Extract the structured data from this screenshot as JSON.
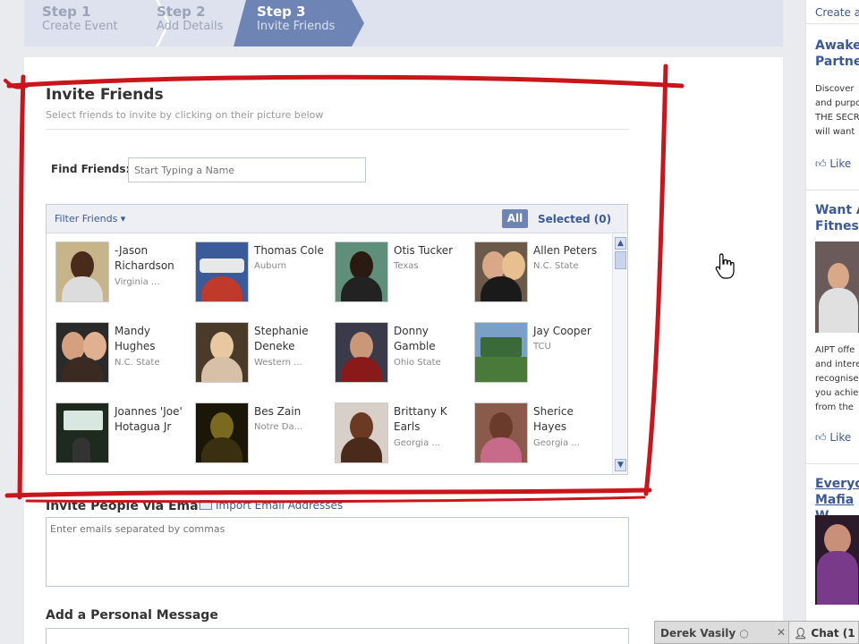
{
  "steps": [
    {
      "num": "Step 1",
      "label": "Create Event"
    },
    {
      "num": "Step 2",
      "label": "Add Details"
    },
    {
      "num": "Step 3",
      "label": "Invite Friends"
    }
  ],
  "invite": {
    "title": "Invite Friends",
    "subtitle": "Select friends to invite by clicking on their picture below",
    "find_label": "Find Friends:",
    "find_placeholder": "Start Typing a Name",
    "filter_label": "Filter Friends ▾",
    "all_label": "All",
    "selected_label": "Selected (0)"
  },
  "friends": [
    {
      "name": "-Jason Richardson",
      "network": "Virginia ..."
    },
    {
      "name": "Thomas Cole",
      "network": "Auburn"
    },
    {
      "name": "Otis Tucker",
      "network": "Texas"
    },
    {
      "name": "Allen Peters",
      "network": "N.C. State"
    },
    {
      "name": "Mandy Hughes",
      "network": "N.C. State"
    },
    {
      "name": "Stephanie Deneke",
      "network": "Western ..."
    },
    {
      "name": "Donny Gamble",
      "network": "Ohio State"
    },
    {
      "name": "Jay Cooper",
      "network": "TCU"
    },
    {
      "name": "Joannes 'Joe' Hotagua Jr",
      "network": ""
    },
    {
      "name": "Bes Zain",
      "network": "Notre Da..."
    },
    {
      "name": "Brittany K Earls",
      "network": "Georgia ..."
    },
    {
      "name": "Sherice Hayes",
      "network": "Georgia ..."
    }
  ],
  "email": {
    "title": "Invite People via Email",
    "import_label": "Import Email Addresses",
    "placeholder": "Enter emails separated by commas"
  },
  "message": {
    "title": "Add a Personal Message"
  },
  "sidebar": {
    "create_link": "Create an",
    "ads": [
      {
        "title": "Awaken Partner",
        "lines": [
          "Discover",
          "and purpo",
          "THE SECR",
          "will want"
        ],
        "like": "Like"
      },
      {
        "title": "Want A Fitness",
        "lines": [
          "AIPT offe",
          "and intere",
          "recognise",
          "you achie",
          "from the"
        ],
        "like": "Like"
      },
      {
        "title": "Everyon Mafia W",
        "lines": [],
        "like": ""
      }
    ]
  },
  "chat": {
    "tab_user": "Derek Vasily",
    "status_icon": "○",
    "close": "✕",
    "chat_label": "Chat (1"
  },
  "colors": {
    "accent": "#3b5998",
    "step_active": "#6d84b4",
    "highlight_red": "#c8161c"
  }
}
